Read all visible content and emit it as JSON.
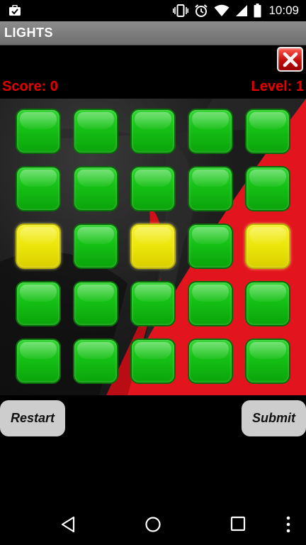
{
  "status_bar": {
    "time": "10:09",
    "icons": [
      "briefcase-check-icon",
      "vibrate-icon",
      "alarm-icon",
      "wifi-icon",
      "signal-icon",
      "battery-icon"
    ]
  },
  "app": {
    "title": "LIGHTS"
  },
  "close_button": {
    "icon": "close-icon",
    "color": "#c20f0a"
  },
  "game": {
    "score_label": "Score: 0",
    "level_label": "Level: 1",
    "grid": {
      "rows": 5,
      "cols": 5,
      "cells": [
        [
          "green",
          "green",
          "green",
          "green",
          "green"
        ],
        [
          "green",
          "green",
          "green",
          "green",
          "green"
        ],
        [
          "yellow",
          "green",
          "yellow",
          "green",
          "yellow"
        ],
        [
          "green",
          "green",
          "green",
          "green",
          "green"
        ],
        [
          "green",
          "green",
          "green",
          "green",
          "green"
        ]
      ]
    },
    "colors": {
      "on": "#15c015",
      "off": "#ece50a",
      "text_accent": "#e50000"
    }
  },
  "buttons": {
    "restart_label": "Restart",
    "submit_label": "Submit"
  },
  "nav_bar": {
    "icons": [
      "back-icon",
      "home-icon",
      "recents-icon",
      "overflow-menu-icon"
    ]
  }
}
